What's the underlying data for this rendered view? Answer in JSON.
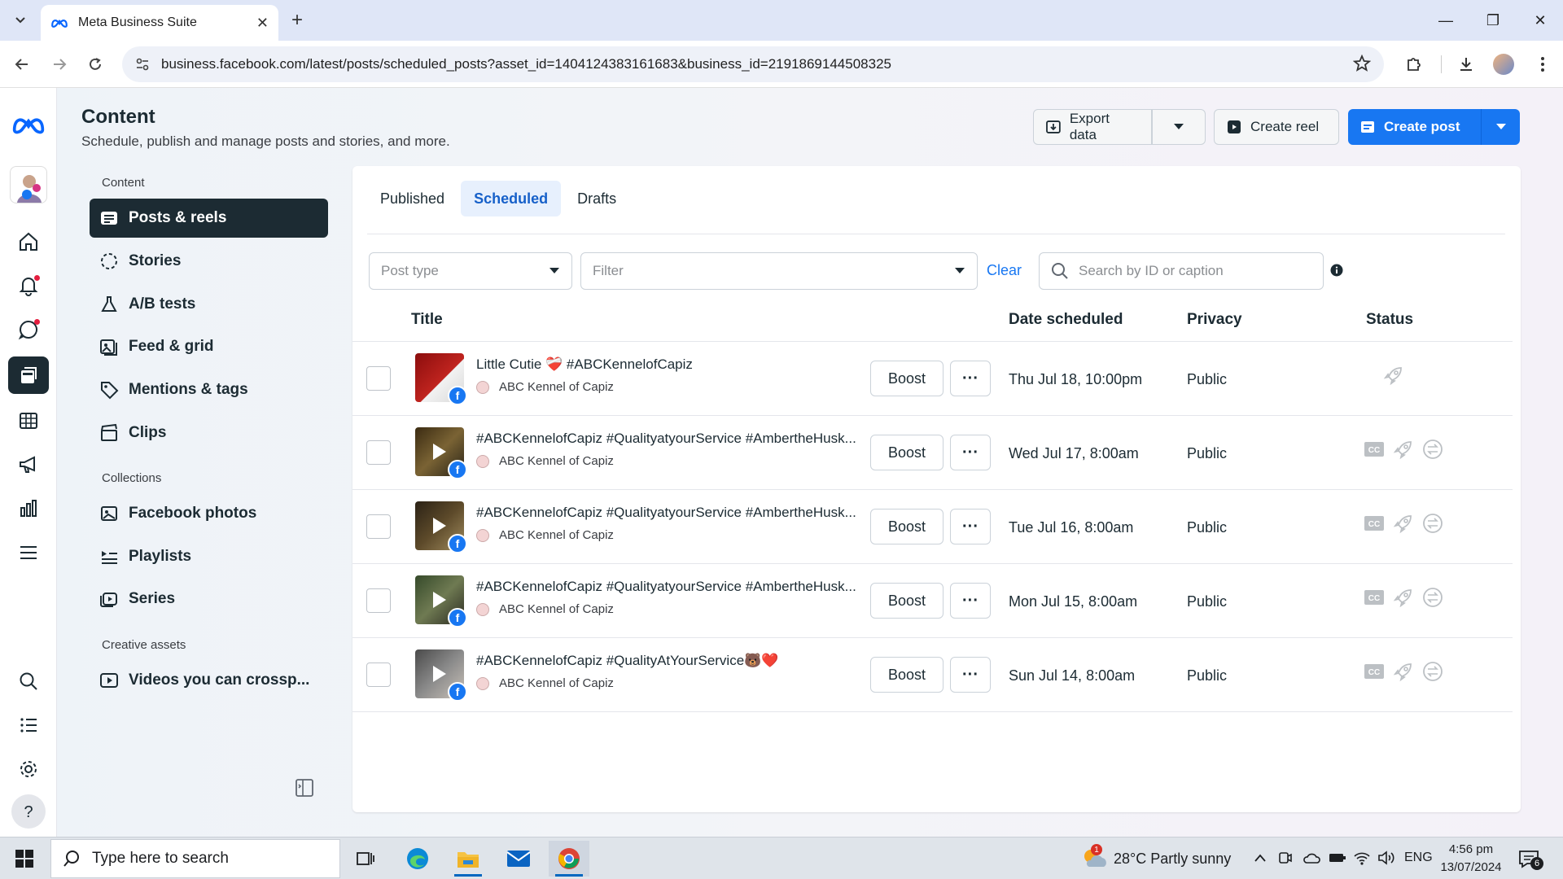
{
  "browser": {
    "tab_title": "Meta Business Suite",
    "url": "business.facebook.com/latest/posts/scheduled_posts?asset_id=1404124383161683&business_id=2191869144508325"
  },
  "header": {
    "title": "Content",
    "subtitle": "Schedule, publish and manage posts and stories, and more.",
    "export_label": "Export data",
    "create_reel_label": "Create reel",
    "create_post_label": "Create post"
  },
  "sidebar": {
    "section_content": "Content",
    "section_collections": "Collections",
    "section_creative": "Creative assets",
    "items": [
      {
        "label": "Posts & reels"
      },
      {
        "label": "Stories"
      },
      {
        "label": "A/B tests"
      },
      {
        "label": "Feed & grid"
      },
      {
        "label": "Mentions & tags"
      },
      {
        "label": "Clips"
      },
      {
        "label": "Facebook photos"
      },
      {
        "label": "Playlists"
      },
      {
        "label": "Series"
      },
      {
        "label": "Videos you can crossp..."
      }
    ]
  },
  "tabs": [
    {
      "label": "Published"
    },
    {
      "label": "Scheduled"
    },
    {
      "label": "Drafts"
    }
  ],
  "filters": {
    "post_type_placeholder": "Post type",
    "filter_placeholder": "Filter",
    "clear_label": "Clear",
    "search_placeholder": "Search by ID or caption"
  },
  "table": {
    "columns": {
      "title": "Title",
      "date": "Date scheduled",
      "privacy": "Privacy",
      "status": "Status"
    },
    "boost_label": "Boost",
    "rows": [
      {
        "title": "Little Cutie ❤️‍🩹 #ABCKennelofCapiz",
        "page": "ABC Kennel of Capiz",
        "date": "Thu Jul 18, 10:00pm",
        "privacy": "Public"
      },
      {
        "title": "#ABCKennelofCapiz #QualityatyourService #AmbertheHusk...",
        "page": "ABC Kennel of Capiz",
        "date": "Wed Jul 17, 8:00am",
        "privacy": "Public"
      },
      {
        "title": "#ABCKennelofCapiz #QualityatyourService #AmbertheHusk...",
        "page": "ABC Kennel of Capiz",
        "date": "Tue Jul 16, 8:00am",
        "privacy": "Public"
      },
      {
        "title": "#ABCKennelofCapiz #QualityatyourService #AmbertheHusk...",
        "page": "ABC Kennel of Capiz",
        "date": "Mon Jul 15, 8:00am",
        "privacy": "Public"
      },
      {
        "title": "#ABCKennelofCapiz #QualityAtYourService🐻❤️",
        "page": "ABC Kennel of Capiz",
        "date": "Sun Jul 14, 8:00am",
        "privacy": "Public"
      }
    ]
  },
  "taskbar": {
    "search_placeholder": "Type here to search",
    "weather": "28°C  Partly sunny",
    "language": "ENG",
    "time": "4:56 pm",
    "date": "13/07/2024",
    "notification_count": "6",
    "weather_badge": "1"
  },
  "colors": {
    "accent": "#1877f2",
    "nav_dark": "#1c2b33",
    "tab_active_bg": "#e7f0fd"
  }
}
